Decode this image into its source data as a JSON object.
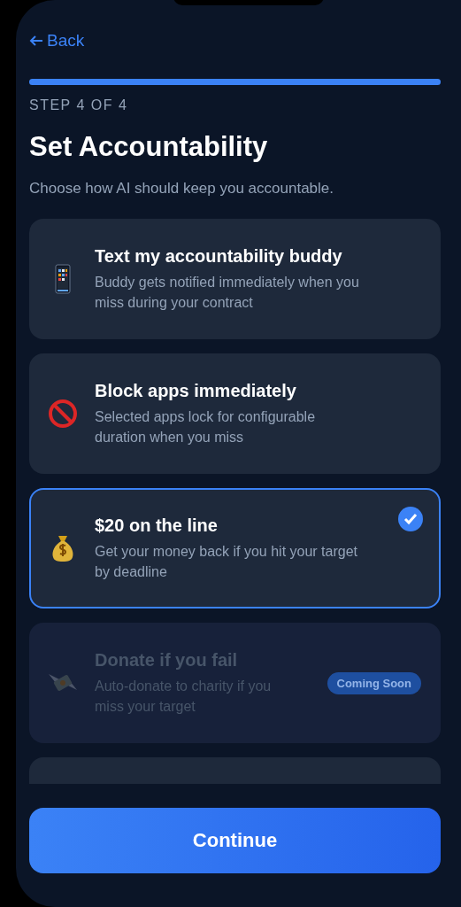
{
  "back": {
    "label": "Back"
  },
  "progress": {
    "level": 1
  },
  "step": "STEP 4 OF 4",
  "title": "Set Accountability",
  "subtitle": "Choose how AI should keep you accountable.",
  "options": [
    {
      "kind": "phone",
      "title": "Text my accountability buddy",
      "description": "Buddy gets notified immediately when you miss during your contract",
      "selected": false,
      "disabled": false
    },
    {
      "kind": "prohibited",
      "title": "Block apps immediately",
      "description": "Selected apps lock for configurable duration when you miss",
      "selected": false,
      "disabled": false
    },
    {
      "kind": "moneybag",
      "title": "$20 on the line",
      "description": "Get your money back if you hit your target by deadline",
      "selected": true,
      "disabled": false
    },
    {
      "kind": "flyingmoney",
      "title": "Donate if you fail",
      "description": "Auto-donate to charity if you miss your target",
      "selected": false,
      "disabled": true,
      "badge": "Coming Soon"
    }
  ],
  "continue_button": "Continue"
}
